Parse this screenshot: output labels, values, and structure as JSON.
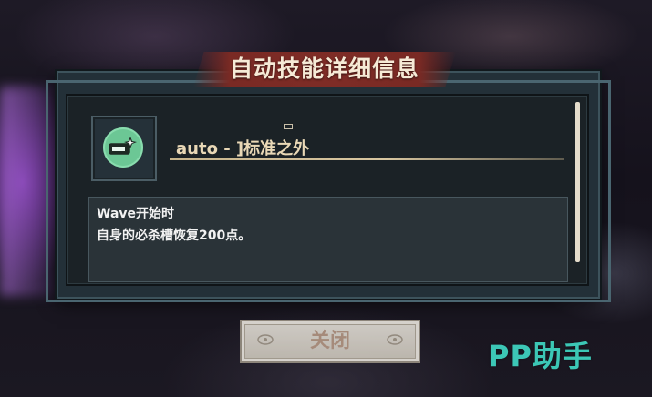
{
  "dialog": {
    "title": "自动技能详细信息",
    "marker": "▭"
  },
  "skill": {
    "icon": "auto-skill-gauge-icon",
    "name": "auto - ]标准之外"
  },
  "description": {
    "line1": "Wave开始时",
    "line2": "自身的必杀槽恢复200点。"
  },
  "close_button": {
    "label": "关闭"
  },
  "watermark": {
    "text": "PP助手"
  },
  "colors": {
    "title_banner": "#7e2c26",
    "icon_green": "#6cc795",
    "name_text": "#e9d8b6",
    "watermark": "#3cc7b6"
  }
}
